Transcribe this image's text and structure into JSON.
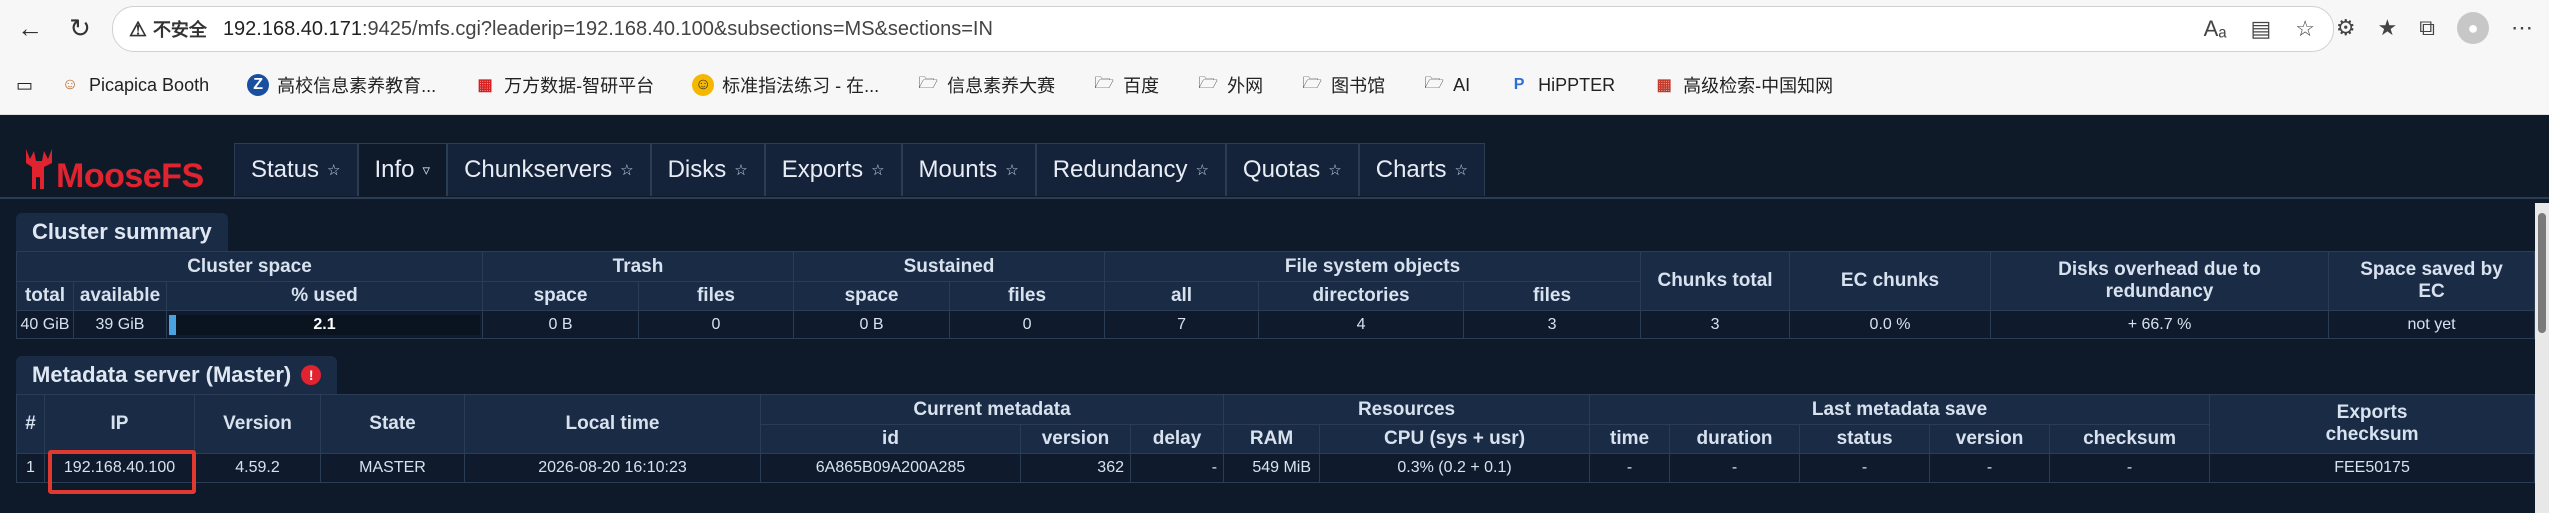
{
  "browser": {
    "security_label": "不安全",
    "url_host": "192.168.40.171",
    "url_rest": ":9425/mfs.cgi?leaderip=192.168.40.100&subsections=MS&sections=IN"
  },
  "bookmarks": [
    {
      "label": "Picapica Booth",
      "icon": "picapica-icon"
    },
    {
      "label": "高校信息素养教育...",
      "icon": "z-icon"
    },
    {
      "label": "万方数据-智研平台",
      "icon": "wanfang-icon"
    },
    {
      "label": "标准指法练习 - 在...",
      "icon": "emoji-icon"
    },
    {
      "label": "信息素养大赛",
      "icon": "folder-icon"
    },
    {
      "label": "百度",
      "icon": "folder-icon"
    },
    {
      "label": "外网",
      "icon": "folder-icon"
    },
    {
      "label": "图书馆",
      "icon": "folder-icon"
    },
    {
      "label": "AI",
      "icon": "folder-icon"
    },
    {
      "label": "HiPPTER",
      "icon": "p-icon"
    },
    {
      "label": "高级检索-中国知网",
      "icon": "cnki-icon"
    }
  ],
  "app": {
    "logo": "MooseFS",
    "tabs": [
      {
        "label": "Status",
        "active": false
      },
      {
        "label": "Info",
        "active": true
      },
      {
        "label": "Chunkservers",
        "active": false
      },
      {
        "label": "Disks",
        "active": false
      },
      {
        "label": "Exports",
        "active": false
      },
      {
        "label": "Mounts",
        "active": false
      },
      {
        "label": "Redundancy",
        "active": false
      },
      {
        "label": "Quotas",
        "active": false
      },
      {
        "label": "Charts",
        "active": false
      }
    ]
  },
  "cluster_summary": {
    "title": "Cluster summary",
    "groups": {
      "cluster_space": "Cluster space",
      "trash": "Trash",
      "sustained": "Sustained",
      "fs_objects": "File system objects",
      "chunks_total": "Chunks total",
      "ec_chunks": "EC chunks",
      "disks_overhead": "Disks overhead due to redundancy",
      "space_saved": "Space saved by EC"
    },
    "subheaders": {
      "total": "total",
      "available": "available",
      "pct_used": "% used",
      "trash_space": "space",
      "trash_files": "files",
      "sus_space": "space",
      "sus_files": "files",
      "all": "all",
      "directories": "directories",
      "files": "files"
    },
    "row": {
      "total": "40 GiB",
      "available": "39 GiB",
      "pct_used": "2.1",
      "pct_used_value": 2.1,
      "trash_space": "0 B",
      "trash_files": "0",
      "sus_space": "0 B",
      "sus_files": "0",
      "all": "7",
      "directories": "4",
      "files": "3",
      "chunks_total": "3",
      "ec_chunks": "0.0 %",
      "disks_overhead": "+ 66.7 %",
      "space_saved": "not yet"
    }
  },
  "metadata": {
    "title": "Metadata server (Master)",
    "headers": {
      "num": "#",
      "ip": "IP",
      "version": "Version",
      "state": "State",
      "local_time": "Local time",
      "current_metadata": "Current metadata",
      "id": "id",
      "meta_version": "version",
      "delay": "delay",
      "resources": "Resources",
      "ram": "RAM",
      "cpu": "CPU (sys + usr)",
      "last_save": "Last metadata save",
      "time": "time",
      "duration": "duration",
      "status": "status",
      "save_version": "version",
      "checksum": "checksum",
      "exports_checksum": "Exports checksum"
    },
    "row": {
      "num": "1",
      "ip": "192.168.40.100",
      "version": "4.59.2",
      "state": "MASTER",
      "local_time": "2026-08-20 16:10:23",
      "id": "6A865B09A200A285",
      "meta_version": "362",
      "delay": "-",
      "ram": "549 MiB",
      "cpu": "0.3% (0.2 + 0.1)",
      "time": "-",
      "duration": "-",
      "status": "-",
      "save_version": "-",
      "checksum": "-",
      "exports_checksum": "FEE50175"
    }
  }
}
